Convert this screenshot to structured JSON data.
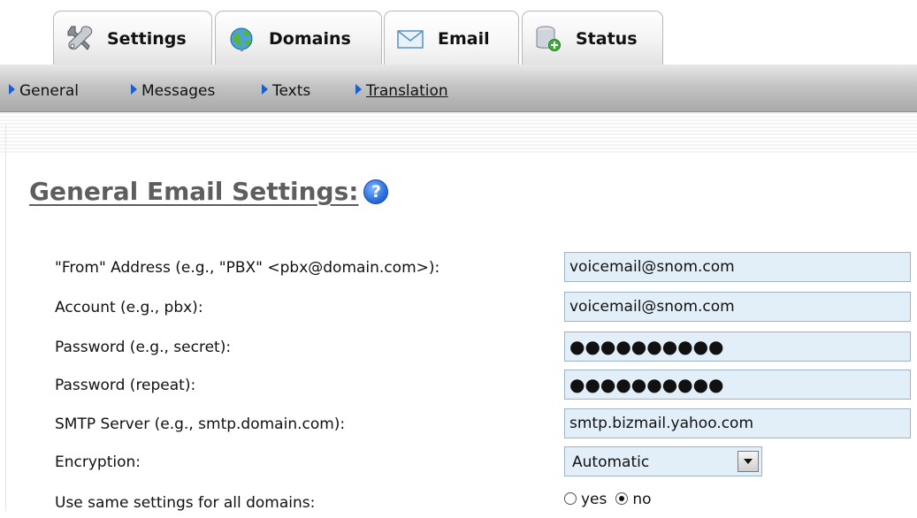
{
  "tabs": [
    {
      "label": "Settings",
      "icon": "tools-icon"
    },
    {
      "label": "Domains",
      "icon": "globe-icon"
    },
    {
      "label": "Email",
      "icon": "envelope-icon"
    },
    {
      "label": "Status",
      "icon": "database-status-icon"
    }
  ],
  "active_tab": "Email",
  "subnav": [
    {
      "label": "General"
    },
    {
      "label": "Messages"
    },
    {
      "label": "Texts"
    },
    {
      "label": "Translation"
    }
  ],
  "page_title": "General Email Settings:",
  "form": {
    "from_label": "\"From\" Address (e.g., \"PBX\" <pbx@domain.com>):",
    "from_value": "voicemail@snom.com",
    "account_label": "Account (e.g., pbx):",
    "account_value": "voicemail@snom.com",
    "password_label": "Password (e.g., secret):",
    "password_value": "●●●●●●●●●●",
    "password_repeat_label": "Password (repeat):",
    "password_repeat_value": "●●●●●●●●●●",
    "smtp_label": "SMTP Server (e.g., smtp.domain.com):",
    "smtp_value": "smtp.bizmail.yahoo.com",
    "encryption_label": "Encryption:",
    "encryption_value": "Automatic",
    "same_settings_label": "Use same settings for all domains:",
    "same_settings_options": [
      "yes",
      "no"
    ],
    "same_settings_selected": "no"
  },
  "colors": {
    "field_bg": "#e3eff8",
    "field_border": "#9fb3c7",
    "heading": "#5e5e5e",
    "nav_arrow": "#1a5fd0"
  }
}
